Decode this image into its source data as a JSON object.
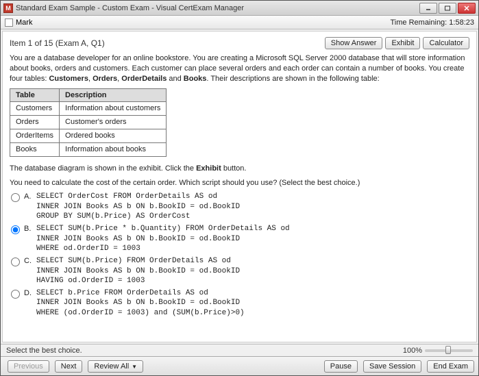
{
  "title": "Standard Exam Sample - Custom Exam - Visual CertExam Manager",
  "icon_letter": "M",
  "topbar": {
    "mark_label": "Mark",
    "time_label": "Time Remaining: 1:58:23"
  },
  "header": {
    "item": "Item 1 of 15  (Exam A, Q1)",
    "show_answer": "Show Answer",
    "exhibit": "Exhibit",
    "calculator": "Calculator"
  },
  "question": {
    "p1a": "You are a database developer for an online bookstore. You are creating a Microsoft SQL Server 2000 database that will store information about books, orders and customers. Each customer can place several orders and each order can contain a number of books. You create four tables: ",
    "p1b_bold": "Customers",
    "comma1": ", ",
    "p1c_bold": "Orders",
    "comma2": ", ",
    "p1d_bold": "OrderDetails",
    "and": " and ",
    "p1e_bold": "Books",
    "p1f": ". Their descriptions are shown in the following table:",
    "p2a": "The database diagram is shown in the exhibit. Click the ",
    "p2b_bold": "Exhibit",
    "p2c": " button.",
    "p3": "You need to calculate the cost of the certain order. Which script should you use? (Select the best choice.)"
  },
  "table": {
    "h1": "Table",
    "h2": "Description",
    "rows": [
      {
        "c1": "Customers",
        "c2": "Information about customers"
      },
      {
        "c1": "Orders",
        "c2": "Customer's orders"
      },
      {
        "c1": "OrderItems",
        "c2": "Ordered books"
      },
      {
        "c1": "Books",
        "c2": "Information about books"
      }
    ]
  },
  "choices": [
    {
      "letter": "A.",
      "text": "SELECT OrderCost FROM OrderDetails AS od\nINNER JOIN Books AS b ON b.BookID = od.BookID\nGROUP BY SUM(b.Price) AS OrderCost",
      "selected": false
    },
    {
      "letter": "B.",
      "text": "SELECT SUM(b.Price * b.Quantity) FROM OrderDetails AS od\nINNER JOIN Books AS b ON b.BookID = od.BookID\nWHERE od.OrderID = 1003",
      "selected": true
    },
    {
      "letter": "C.",
      "text": "SELECT SUM(b.Price) FROM OrderDetails AS od\nINNER JOIN Books AS b ON b.BookID = od.BookID\nHAVING od.OrderID = 1003",
      "selected": false
    },
    {
      "letter": "D.",
      "text": "SELECT b.Price FROM OrderDetails AS od\nINNER JOIN Books AS b ON b.BookID = od.BookID\nWHERE (od.OrderID = 1003) and (SUM(b.Price)>0)",
      "selected": false
    }
  ],
  "status": {
    "hint": "Select the best choice.",
    "zoom": "100%"
  },
  "bottom": {
    "previous": "Previous",
    "next": "Next",
    "review": "Review All",
    "pause": "Pause",
    "save": "Save Session",
    "end": "End Exam"
  }
}
